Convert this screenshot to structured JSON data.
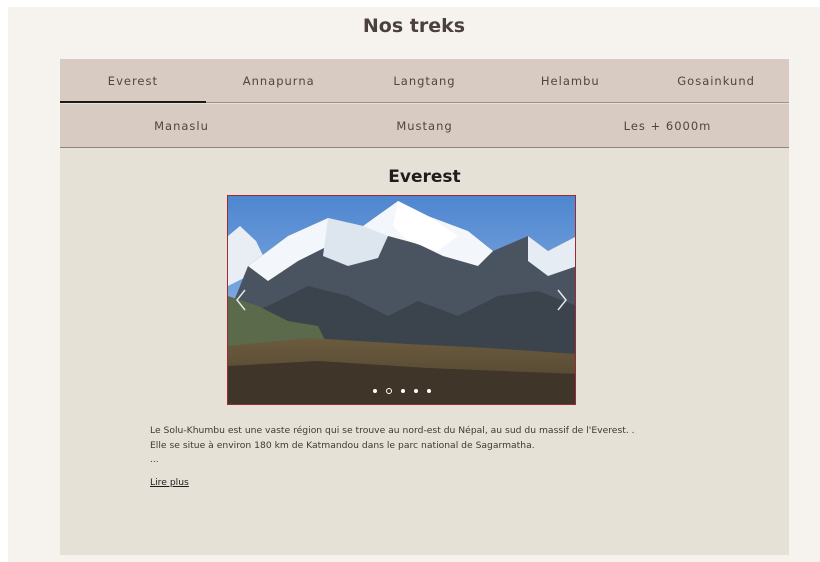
{
  "page": {
    "title": "Nos treks"
  },
  "tabs": {
    "row1": [
      "Everest",
      "Annapurna",
      "Langtang",
      "Helambu",
      "Gosainkund"
    ],
    "row2": [
      "Manaslu",
      "Mustang",
      "Les + 6000m"
    ],
    "active": "Everest"
  },
  "content": {
    "title": "Everest",
    "description": "Le Solu-Khumbu est une vaste région qui se trouve au nord-est du Népal, au sud du massif de l'Everest. . Elle se situe à environ 180 km de Katmandou dans le parc national de Sagarmatha.",
    "ellipsis": "...",
    "read_more": "Lire plus"
  },
  "carousel": {
    "slide_count": 5,
    "active_slide": 2,
    "prev_icon": "chevron-left-icon",
    "next_icon": "chevron-right-icon"
  }
}
